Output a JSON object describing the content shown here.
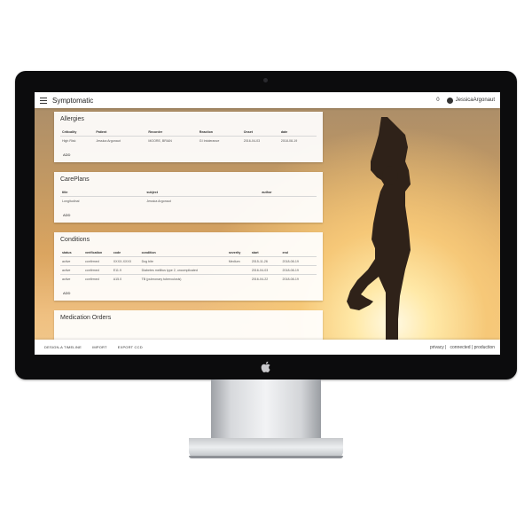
{
  "header": {
    "app_title": "Symptomatic",
    "count": "0",
    "user_name": "JessicaArgonaut"
  },
  "cards": {
    "allergies": {
      "title": "Allergies",
      "columns": [
        "Criticality",
        "Patient",
        "Recorder",
        "Reaction",
        "Onset",
        "date"
      ],
      "rows": [
        [
          "High Risk",
          "Jessica Argonaut",
          "MOORE, BRIAN",
          "GI Intolerance",
          "2016-04-03",
          "2018-08-19"
        ]
      ],
      "add_label": "ADD"
    },
    "careplans": {
      "title": "CarePlans",
      "columns": [
        "title",
        "subject",
        "author"
      ],
      "rows": [
        [
          "Longitudinal",
          "Jessica Argonaut",
          ""
        ]
      ],
      "add_label": "ADD"
    },
    "conditions": {
      "title": "Conditions",
      "columns": [
        "status",
        "verification",
        "code",
        "condition",
        "severity",
        "start",
        "end"
      ],
      "rows": [
        [
          "active",
          "confirmed",
          "XXXX-XXXX",
          "Dog bite",
          "Medium",
          "2015-11-26",
          "2018-08-19"
        ],
        [
          "active",
          "confirmed",
          "E11.9",
          "Diabetes mellitus type 2, uncomplicated",
          "",
          "2016-04-03",
          "2018-08-19"
        ],
        [
          "active",
          "confirmed",
          "A15.0",
          "TB (pulmonary tuberculosis)",
          "",
          "2016-04-22",
          "2018-08-19"
        ]
      ],
      "add_label": "ADD"
    },
    "medication_orders": {
      "title": "Medication Orders"
    }
  },
  "footer": {
    "buttons": [
      "DESIGN-A TIMELINE",
      "IMPORT",
      "EXPORT CCD"
    ],
    "privacy": "privacy |",
    "status": "connected | production"
  },
  "colors": {
    "background_sky": "#dba560",
    "sun": "#fff9e4",
    "card": "#ffffff"
  }
}
